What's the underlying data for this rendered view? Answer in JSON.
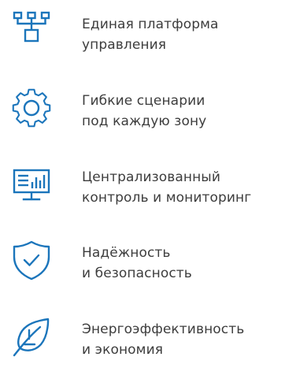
{
  "accent_color": "#1b75bb",
  "features": [
    {
      "icon": "hierarchy-icon",
      "line1": "Единая платформа",
      "line2": "управления"
    },
    {
      "icon": "gear-icon",
      "line1": "Гибкие сценарии",
      "line2": "под каждую зону"
    },
    {
      "icon": "monitor-chart-icon",
      "line1": "Централизованный",
      "line2": "контроль и мониторинг"
    },
    {
      "icon": "shield-check-icon",
      "line1": "Надёжность",
      "line2": "и безопасность"
    },
    {
      "icon": "leaf-icon",
      "line1": "Энергоэффективность",
      "line2": "и экономия"
    }
  ]
}
